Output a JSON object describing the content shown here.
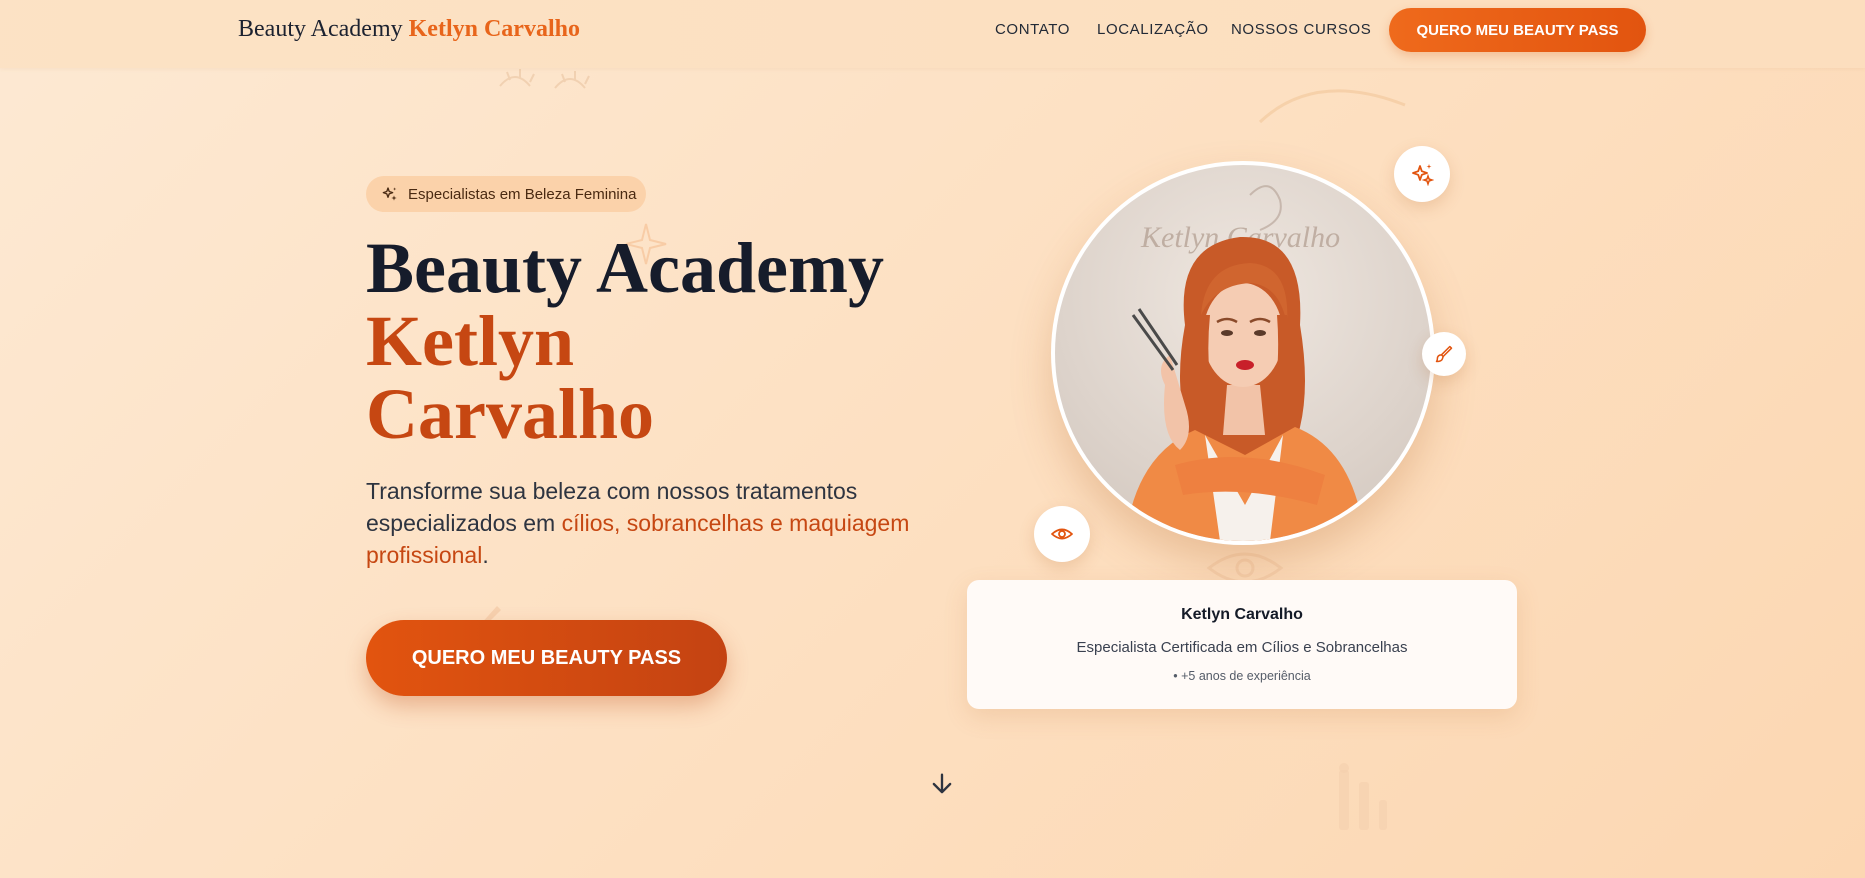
{
  "header": {
    "logo_main": "Beauty Academy",
    "logo_accent": "Ketlyn Carvalho",
    "nav": [
      "CONTATO",
      "LOCALIZAÇÃO",
      "NOSSOS CURSOS"
    ],
    "cta_label": "QUERO MEU BEAUTY PASS"
  },
  "hero": {
    "badge": "Especialistas em Beleza Feminina",
    "title_line1": "Beauty Academy",
    "title_line2": "Ketlyn",
    "title_line3": "Carvalho",
    "subtitle_start": "Transforme sua beleza com nossos tratamentos especializados em ",
    "subtitle_highlight": "cílios, sobrancelhas e maquiagem profissional",
    "subtitle_end": ".",
    "cta_label": "QUERO MEU BEAUTY PASS"
  },
  "profile": {
    "name": "Ketlyn Carvalho",
    "role": "Especialista Certificada em Cílios e Sobrancelhas",
    "experience": "• +5 anos de experiência",
    "wall_text": "Ketlyn Carvalho"
  },
  "icons": {
    "badge": "sparkles-icon",
    "float_top": "sparkles-icon",
    "float_right": "brush-icon",
    "float_left": "eye-icon",
    "scroll": "arrow-down-icon"
  },
  "colors": {
    "accent": "#e8651b",
    "accent_dark": "#c64712",
    "background": "#fde3c8"
  }
}
